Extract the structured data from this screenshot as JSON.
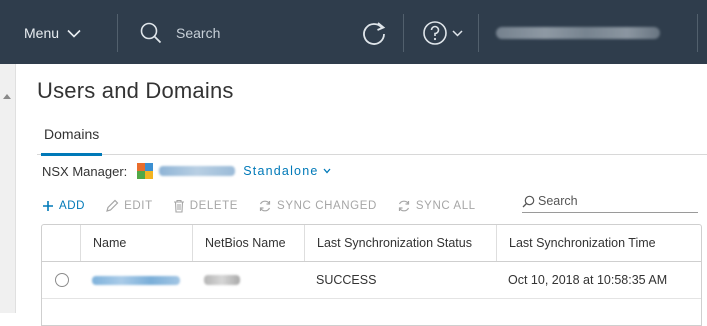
{
  "header": {
    "menu_label": "Menu",
    "search_placeholder": "Search"
  },
  "page": {
    "title": "Users and Domains"
  },
  "tabs": [
    {
      "label": "Domains",
      "selected": true
    }
  ],
  "nsx": {
    "label": "NSX Manager:",
    "mode": "Standalone"
  },
  "toolbar": {
    "add": "ADD",
    "edit": "EDIT",
    "delete": "DELETE",
    "sync_changed": "SYNC CHANGED",
    "sync_all": "SYNC ALL",
    "search_placeholder": "Search"
  },
  "grid": {
    "columns": [
      "Name",
      "NetBios Name",
      "Last Synchronization Status",
      "Last Synchronization Time"
    ],
    "rows": [
      {
        "status": "SUCCESS",
        "time": "Oct 10, 2018 at 10:58:35 AM"
      }
    ]
  },
  "colors": {
    "header_bg": "#2f3d4c",
    "accent": "#0079b8",
    "disabled": "#a6a6a6"
  }
}
